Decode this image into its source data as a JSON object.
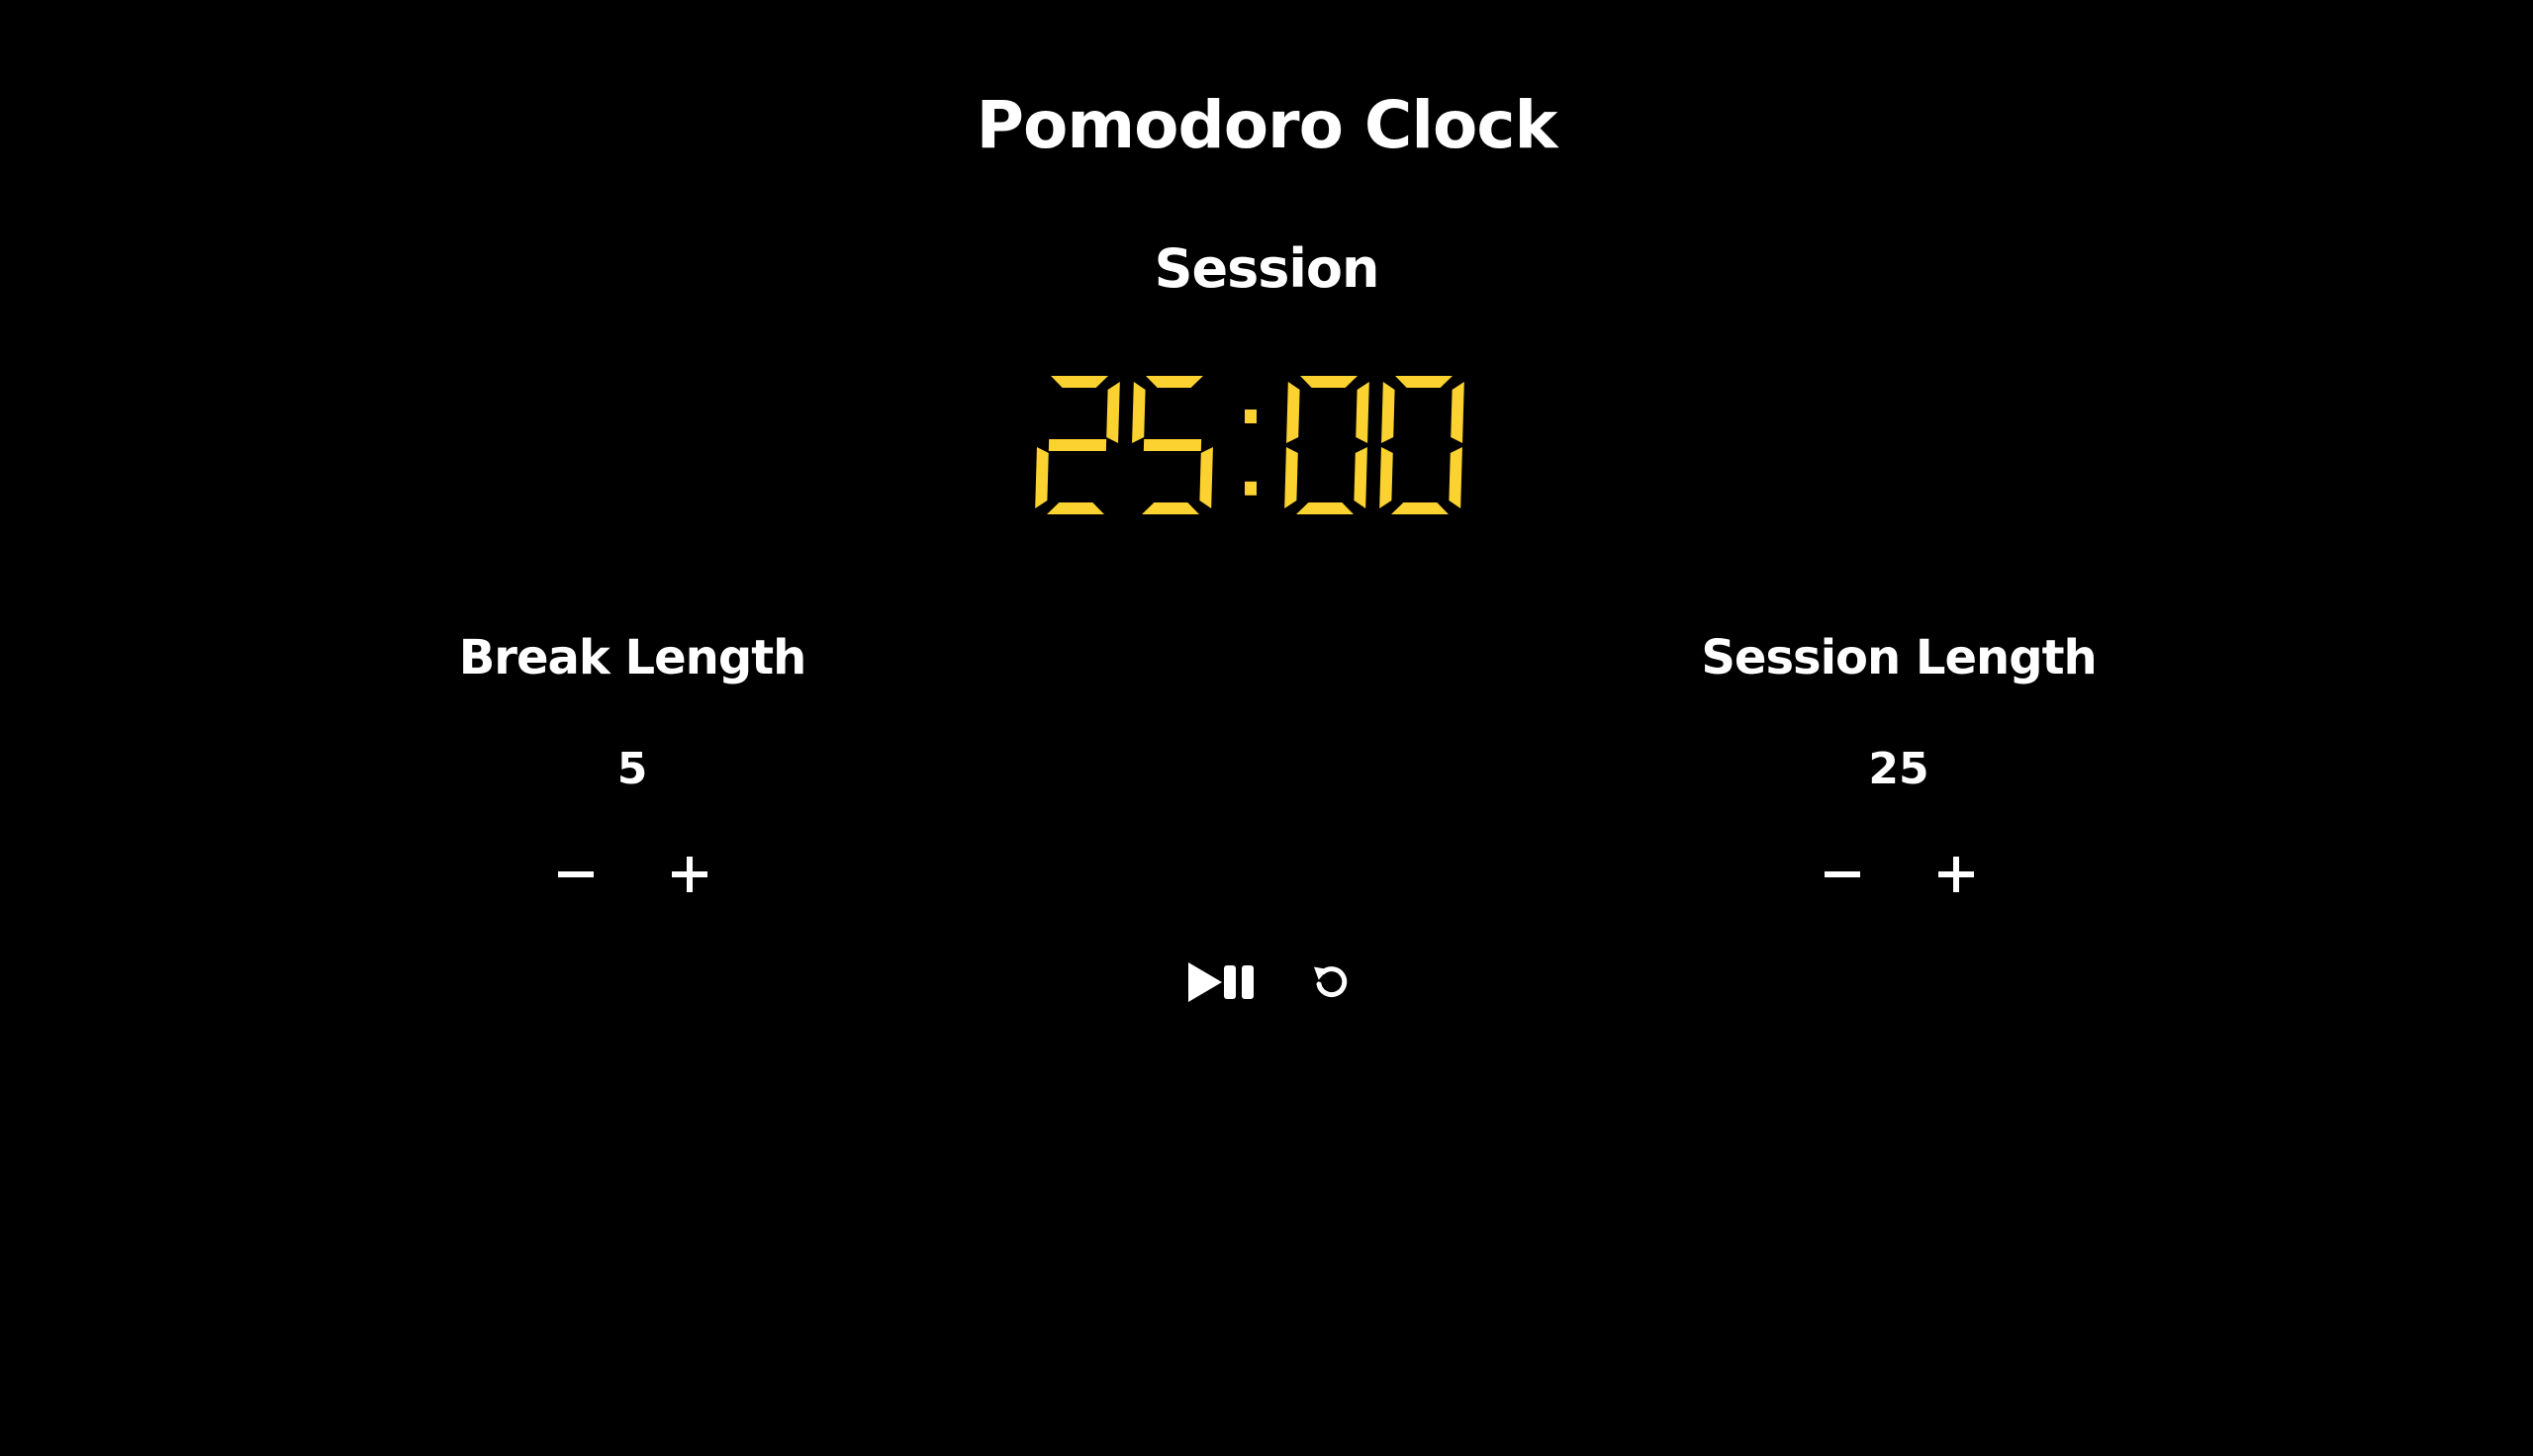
{
  "app": {
    "title": "Pomodoro Clock"
  },
  "timer": {
    "label": "Session",
    "time_left": "25:00",
    "digit_color": "#fbd230"
  },
  "break": {
    "label": "Break Length",
    "value": "5"
  },
  "session": {
    "label": "Session Length",
    "value": "25"
  },
  "controls": {
    "decrement_icon": "minus-icon",
    "increment_icon": "plus-icon",
    "start_stop_icon": "play-pause-icon",
    "reset_icon": "refresh-icon"
  },
  "colors": {
    "background": "#000000",
    "text": "#ffffff",
    "accent": "#fbd230"
  }
}
